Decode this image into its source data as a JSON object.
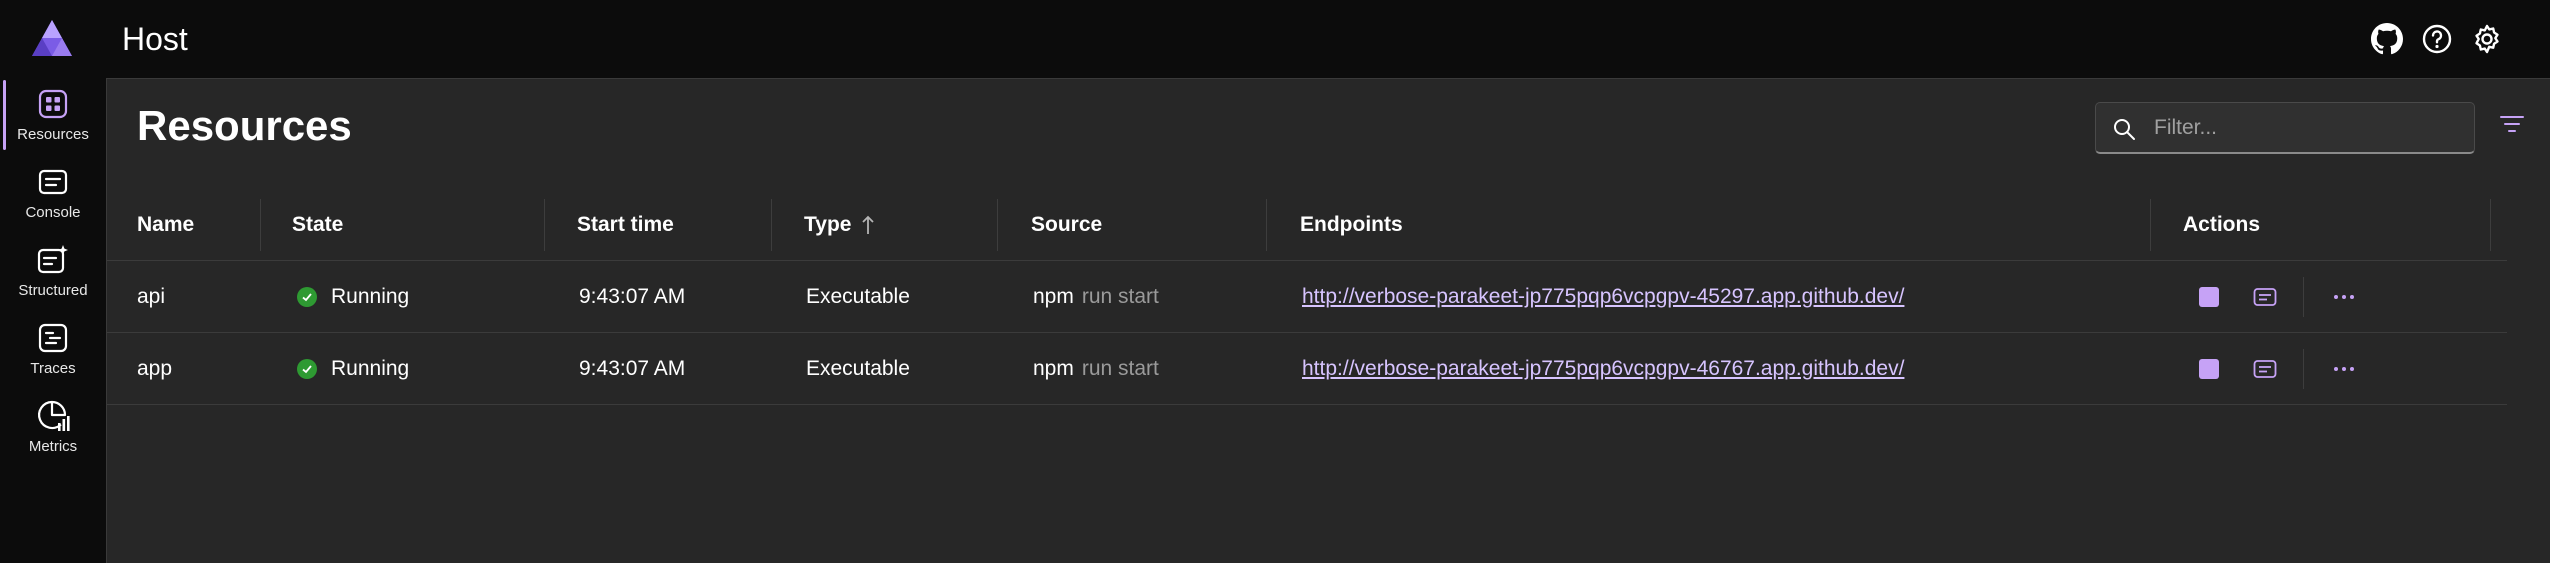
{
  "header": {
    "app_title": "Host",
    "icons": [
      "github-icon",
      "help-icon",
      "settings-icon"
    ]
  },
  "nav": {
    "items": [
      {
        "label": "Resources",
        "icon": "resources-icon",
        "active": true
      },
      {
        "label": "Console",
        "icon": "console-icon",
        "active": false
      },
      {
        "label": "Structured",
        "icon": "structured-logs-icon",
        "active": false
      },
      {
        "label": "Traces",
        "icon": "traces-icon",
        "active": false
      },
      {
        "label": "Metrics",
        "icon": "metrics-icon",
        "active": false
      }
    ]
  },
  "page": {
    "title": "Resources",
    "filter_placeholder": "Filter...",
    "filter_value": ""
  },
  "table": {
    "columns": [
      "Name",
      "State",
      "Start time",
      "Type",
      "Source",
      "Endpoints",
      "Actions"
    ],
    "sorted_column": "Type",
    "sort_direction": "ascending",
    "rows": [
      {
        "name": "api",
        "state": "Running",
        "start_time": "9:43:07 AM",
        "type": "Executable",
        "source_cmd": "npm",
        "source_args": "run start",
        "endpoint": "http://verbose-parakeet-jp775pqp6vcpgpv-45297.app.github.dev/"
      },
      {
        "name": "app",
        "state": "Running",
        "start_time": "9:43:07 AM",
        "type": "Executable",
        "source_cmd": "npm",
        "source_args": "run start",
        "endpoint": "http://verbose-parakeet-jp775pqp6vcpgpv-46767.app.github.dev/"
      }
    ]
  },
  "colors": {
    "accent": "#c6a2f6",
    "link": "#d7c4ff",
    "running": "#2e9a32",
    "panel": "#272727",
    "chrome": "#0c0c0c"
  }
}
